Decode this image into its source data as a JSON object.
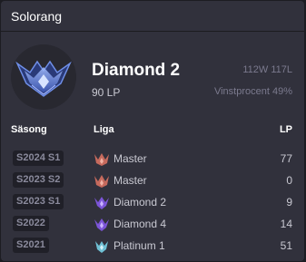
{
  "header": {
    "title": "Solorang"
  },
  "summary": {
    "emblem_icon": "diamond-emblem-icon",
    "tier": "Diamond 2",
    "lp": "90 LP",
    "record": "112W 117L",
    "winrate": "Vinstprocent 49%"
  },
  "table": {
    "headers": {
      "season": "Säsong",
      "league": "Liga",
      "lp": "LP"
    },
    "rows": [
      {
        "season": "S2024 S1",
        "league": "Master",
        "icon": "master-icon",
        "lp": "77"
      },
      {
        "season": "S2023 S2",
        "league": "Master",
        "icon": "master-icon",
        "lp": "0"
      },
      {
        "season": "S2023 S1",
        "league": "Diamond 2",
        "icon": "diamond-icon",
        "lp": "9"
      },
      {
        "season": "S2022",
        "league": "Diamond 4",
        "icon": "diamond-icon",
        "lp": "14"
      },
      {
        "season": "S2021",
        "league": "Platinum 1",
        "icon": "platinum-icon",
        "lp": "51"
      }
    ]
  },
  "colors": {
    "panel_bg": "#31313c",
    "master": "#c66a5d",
    "diamond": "#7c55d8",
    "platinum": "#6fc0d4"
  }
}
